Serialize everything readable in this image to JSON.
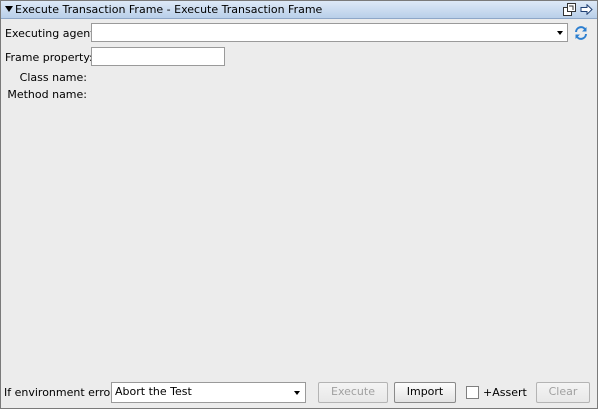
{
  "window": {
    "title": "Execute Transaction Frame - Execute Transaction Frame"
  },
  "icons": {
    "collapse": "collapse-triangle-icon",
    "restore": "restore-window-icon",
    "navigate": "arrow-right-icon",
    "refresh": "refresh-icon"
  },
  "form": {
    "executing_agent_label": "Executing agent:",
    "executing_agent_value": "",
    "frame_property_label": "Frame property:",
    "frame_property_value": "",
    "class_name_label": "Class name:",
    "method_name_label": "Method name:"
  },
  "footer": {
    "env_error_label": "If environment error:",
    "env_error_value": "Abort the Test",
    "execute_label": "Execute",
    "import_label": "Import",
    "assert_label": "+Assert",
    "assert_checked": false,
    "clear_label": "Clear"
  },
  "colors": {
    "titlebar": "#c6d8ee",
    "panel": "#ececec",
    "refresh": "#2d7fd0"
  }
}
